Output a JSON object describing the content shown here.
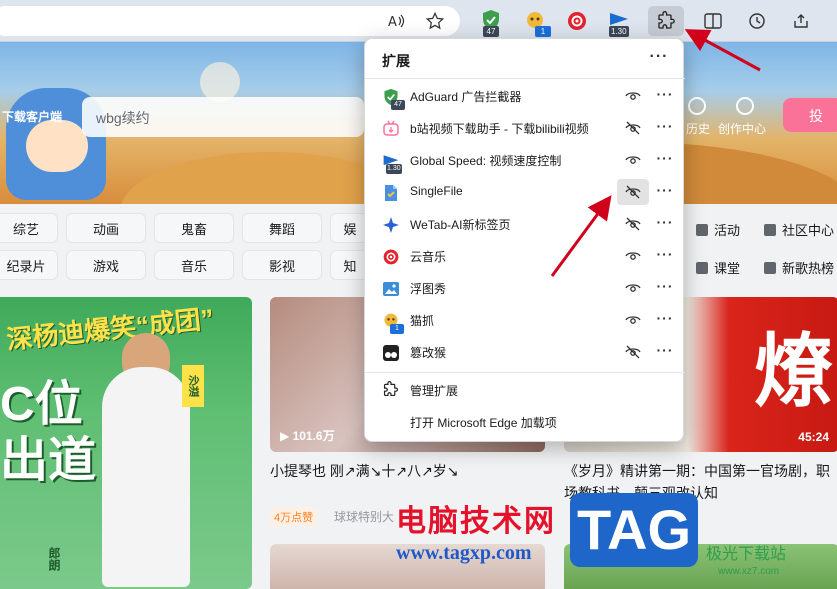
{
  "toolbar": {
    "extensions": [
      {
        "name": "adguard",
        "badge": "47",
        "color": "#3d9f4e"
      },
      {
        "name": "mouse-catch",
        "badge": "1",
        "color": "#f0b93a"
      },
      {
        "name": "netease-music",
        "badge": "",
        "color": "#e2232e"
      },
      {
        "name": "global-speed",
        "badge": "1.30",
        "color": "#1a6cd0"
      }
    ]
  },
  "page": {
    "download_client": "下载客户端",
    "search_value": "wbg续约",
    "header_right": {
      "history": "历史",
      "creator": "创作中心",
      "upload": "投"
    },
    "categories_row1": [
      "综艺",
      "动画",
      "鬼畜",
      "舞蹈",
      "娱"
    ],
    "categories_row2": [
      "纪录片",
      "游戏",
      "音乐",
      "影视",
      "知"
    ],
    "side_categories": [
      "活动",
      "社区中心",
      "课堂",
      "新歌热榜"
    ],
    "card1": {
      "title_top": "深杨迪爆笑“成团”",
      "title_big": "C位\n出道",
      "tag": "沙溢",
      "bottom_tag": "郎朗"
    },
    "card2": {
      "views": "101.6万",
      "title": "小提琴也 刚↗满↘十↗八↗岁↘",
      "chip": "4万点赞",
      "uploader": "球球特别大"
    },
    "card3": {
      "duration": "45:24",
      "duration_partial": "8",
      "big_char": "燎",
      "title": "《岁月》精讲第一期：中国第一官场剧，职场教科书，颠三观改认知"
    },
    "watermark": {
      "text": "电脑技术网",
      "url": "www.tagxp.com",
      "logo": "TAG",
      "side": "极光下载站",
      "side_url": "www.xz7.com"
    }
  },
  "popup": {
    "title": "扩展",
    "more": "···",
    "extensions": [
      {
        "name": "AdGuard 广告拦截器",
        "icon": "adguard-icon",
        "badge": "47",
        "visible": true,
        "color": "#3d9f4e"
      },
      {
        "name": "b站视频下载助手 - 下载bilibili视频",
        "icon": "bilibili-download-icon",
        "badge": "",
        "visible": false,
        "color": "#fb7299"
      },
      {
        "name": "Global Speed: 视频速度控制",
        "icon": "global-speed-icon",
        "badge": "1.30",
        "visible": true,
        "color": "#1a6cd0"
      },
      {
        "name": "SingleFile",
        "icon": "singlefile-icon",
        "badge": "",
        "visible": false,
        "color": "#4a90e2",
        "highlighted": true
      },
      {
        "name": "WeTab-AI新标签页",
        "icon": "wetab-icon",
        "badge": "",
        "visible": false,
        "color": "#2b5fd9"
      },
      {
        "name": "云音乐",
        "icon": "cloud-music-icon",
        "badge": "",
        "visible": true,
        "color": "#e2232e"
      },
      {
        "name": "浮图秀",
        "icon": "futuxiu-icon",
        "badge": "",
        "visible": true,
        "color": "#3b8fd9"
      },
      {
        "name": "猫抓",
        "icon": "maozhua-icon",
        "badge": "1",
        "visible": true,
        "color": "#f0b93a"
      },
      {
        "name": "篡改猴",
        "icon": "tampermonkey-icon",
        "badge": "",
        "visible": false,
        "color": "#222222"
      }
    ],
    "manage": "管理扩展",
    "open_addons": "打开 Microsoft Edge 加载项"
  }
}
